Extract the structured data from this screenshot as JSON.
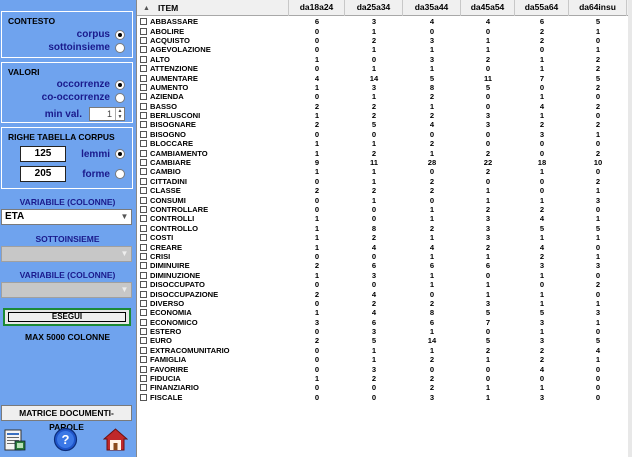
{
  "contesto": {
    "title": "CONTESTO",
    "corpus_label": "corpus",
    "corpus_selected": true,
    "sottoinsieme_label": "sottoinsieme",
    "sottoinsieme_selected": false
  },
  "valori": {
    "title": "VALORI",
    "occorrenze_label": "occorrenze",
    "occorrenze_selected": true,
    "cooccorrenze_label": "co-occorrenze",
    "cooccorrenze_selected": false,
    "minval_label": "min val.",
    "minval_value": "1"
  },
  "righe": {
    "title": "RIGHE TABELLA CORPUS",
    "lemmi_value": "125",
    "lemmi_label": "lemmi",
    "lemmi_selected": true,
    "forme_value": "205",
    "forme_label": "forme",
    "forme_selected": false
  },
  "variabile1": {
    "label": "VARIABILE (COLONNE)",
    "value": "ETA"
  },
  "sottoinsieme": {
    "label": "SOTTOINSIEME",
    "value": ""
  },
  "variabile2": {
    "label": "VARIABILE (COLONNE)",
    "value": ""
  },
  "esegui_label": "ESEGUI",
  "max_label": "MAX 5000 COLONNE",
  "matrice_label": "MATRICE DOCUMENTI-PAROLE",
  "icons": [
    "table-export-icon",
    "help-icon",
    "home-icon"
  ],
  "colors": {
    "panel": "#6fa3ee",
    "label_blue": "#1a1a8c",
    "esegui_border": "#1c8a35",
    "home_red": "#c0282a"
  },
  "table": {
    "sort_indicator": "▲",
    "columns": [
      "ITEM",
      "da18a24",
      "da25a34",
      "da35a44",
      "da45a54",
      "da55a64",
      "da64insu"
    ],
    "rows": [
      [
        "ABBASSARE",
        "6",
        "3",
        "4",
        "4",
        "6",
        "5"
      ],
      [
        "ABOLIRE",
        "0",
        "1",
        "0",
        "0",
        "2",
        "1"
      ],
      [
        "ACQUISTO",
        "0",
        "2",
        "3",
        "1",
        "2",
        "0"
      ],
      [
        "AGEVOLAZIONE",
        "0",
        "1",
        "1",
        "1",
        "0",
        "1"
      ],
      [
        "ALTO",
        "1",
        "0",
        "3",
        "2",
        "1",
        "2"
      ],
      [
        "ATTENZIONE",
        "0",
        "1",
        "1",
        "0",
        "1",
        "2"
      ],
      [
        "AUMENTARE",
        "4",
        "14",
        "5",
        "11",
        "7",
        "5"
      ],
      [
        "AUMENTO",
        "1",
        "3",
        "8",
        "5",
        "0",
        "2"
      ],
      [
        "AZIENDA",
        "0",
        "1",
        "2",
        "0",
        "1",
        "0"
      ],
      [
        "BASSO",
        "2",
        "2",
        "1",
        "0",
        "4",
        "2"
      ],
      [
        "BERLUSCONI",
        "1",
        "2",
        "2",
        "3",
        "1",
        "0"
      ],
      [
        "BISOGNARE",
        "2",
        "5",
        "4",
        "3",
        "2",
        "2"
      ],
      [
        "BISOGNO",
        "0",
        "0",
        "0",
        "0",
        "3",
        "1"
      ],
      [
        "BLOCCARE",
        "1",
        "1",
        "2",
        "0",
        "0",
        "0"
      ],
      [
        "CAMBIAMENTO",
        "1",
        "2",
        "1",
        "2",
        "0",
        "2"
      ],
      [
        "CAMBIARE",
        "9",
        "11",
        "28",
        "22",
        "18",
        "10"
      ],
      [
        "CAMBIO",
        "1",
        "1",
        "0",
        "2",
        "1",
        "0"
      ],
      [
        "CITTADINI",
        "0",
        "1",
        "2",
        "0",
        "0",
        "2"
      ],
      [
        "CLASSE",
        "2",
        "2",
        "2",
        "1",
        "0",
        "1"
      ],
      [
        "CONSUMI",
        "0",
        "1",
        "0",
        "1",
        "1",
        "3"
      ],
      [
        "CONTROLLARE",
        "0",
        "0",
        "1",
        "2",
        "2",
        "0"
      ],
      [
        "CONTROLLI",
        "1",
        "0",
        "1",
        "3",
        "4",
        "1"
      ],
      [
        "CONTROLLO",
        "1",
        "8",
        "2",
        "3",
        "5",
        "5"
      ],
      [
        "COSTI",
        "1",
        "2",
        "1",
        "3",
        "1",
        "1"
      ],
      [
        "CREARE",
        "1",
        "4",
        "4",
        "2",
        "4",
        "0"
      ],
      [
        "CRISI",
        "0",
        "0",
        "1",
        "1",
        "2",
        "1"
      ],
      [
        "DIMINUIRE",
        "2",
        "6",
        "6",
        "6",
        "3",
        "3"
      ],
      [
        "DIMINUZIONE",
        "1",
        "3",
        "1",
        "0",
        "1",
        "0"
      ],
      [
        "DISOCCUPATO",
        "0",
        "0",
        "1",
        "1",
        "0",
        "2"
      ],
      [
        "DISOCCUPAZIONE",
        "2",
        "4",
        "0",
        "1",
        "1",
        "0"
      ],
      [
        "DIVERSO",
        "0",
        "2",
        "2",
        "3",
        "1",
        "1"
      ],
      [
        "ECONOMIA",
        "1",
        "4",
        "8",
        "5",
        "5",
        "3"
      ],
      [
        "ECONOMICO",
        "3",
        "6",
        "6",
        "7",
        "3",
        "1"
      ],
      [
        "ESTERO",
        "0",
        "3",
        "1",
        "0",
        "1",
        "0"
      ],
      [
        "EURO",
        "2",
        "5",
        "14",
        "5",
        "3",
        "5"
      ],
      [
        "EXTRACOMUNITARIO",
        "0",
        "1",
        "1",
        "2",
        "2",
        "4"
      ],
      [
        "FAMIGLIA",
        "0",
        "1",
        "2",
        "1",
        "2",
        "1"
      ],
      [
        "FAVORIRE",
        "0",
        "3",
        "0",
        "0",
        "4",
        "0"
      ],
      [
        "FIDUCIA",
        "1",
        "2",
        "2",
        "0",
        "0",
        "0"
      ],
      [
        "FINANZIARIO",
        "0",
        "0",
        "2",
        "1",
        "1",
        "0"
      ],
      [
        "FISCALE",
        "0",
        "0",
        "3",
        "1",
        "3",
        "0"
      ]
    ]
  }
}
